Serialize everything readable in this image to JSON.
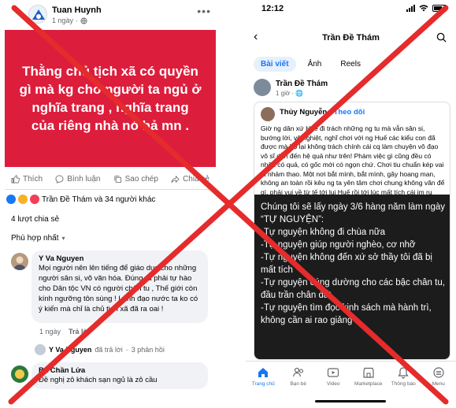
{
  "left_post": {
    "author": "Tuan Huynh",
    "time": "1 ngày",
    "image_text": "Thằng chủ tịch xã có quyền gì mà kg cho người ta ngủ ở nghĩa trang , nghĩa trang của riêng nhà nó hả mn .",
    "actions": {
      "like": "Thích",
      "comment": "Bình luận",
      "copy": "Sao chép",
      "share": "Chia sẻ"
    },
    "reactions_text": "Trần Đề Thám và 34 người khác",
    "shares": "4 lượt chia sẻ",
    "sort_label": "Phù hợp nhất",
    "comment1": {
      "name": "Y Va Nguyen",
      "text": "Mọi người nên lên tiếng để giáo dục cho những người sân si, võ văn hóa. Đúng ra phải tự hào cho Dân tộc VN có người chân tu , Thế giới còn kính ngưỡng tôn sùng ! Lãnh đạo nước ta ko có ý kiến mà chỉ là chủ tịch xã đã ra oai !",
      "time": "1 ngày",
      "reply": "Trả lời"
    },
    "reply_row": {
      "name": "Y Va Nguyen",
      "action": "đã trả lời",
      "count": "3 phản hồi"
    },
    "comment2": {
      "name": "Bá Chần Lửa",
      "text": "Đề nghị zô khách sạn ngủ là zô cầu"
    }
  },
  "right_post": {
    "status_time": "12:12",
    "nav_title": "Trần Đề Thám",
    "tabs": [
      "Bài viết",
      "Ảnh",
      "Reels"
    ],
    "author": "Trần Đề Thám",
    "time": "1 giờ",
    "shared_author": "Thủy Nguyễn",
    "follow": "Theo dõi",
    "shared_text": "Giờ ng dân xứ Huế đi trách những ng tu mà vẫn sân si, bướng lời, vô nghiệt, nghĩ chơi với ng Huế các kiểu con đã được mà họ lại không trách chính cái cq làm chuyện vô đạo vô sĩ dẫn đến hệ quả như trên! Phàm việc gì cũng đều có nhân có quả, có gốc mới có ngọn chứ. Chơi tiu chuẩn kép vai là nhảm thao. Một nơi bắt mình, bắt mình, gây hoang man, không an toàn rồi kêu ng ta yên tâm chơi chung không văn để gì, phải vui về từ tế tới lui Huế rồi tới lúc mất tích cái im ru mặc kệ coi sao đặng😓😓😓",
    "dark_text": [
      "Chúng tôi sẽ lấy ngày 3/6 hàng năm làm ngày “TỰ NGUYỆN”:",
      "-Tự nguyện không đi chùa nữa",
      "-Tự nguyện giúp người nghèo, cơ nhỡ",
      "-Tự nguyện không đến xứ sở thầy tôi đã bị mất tích",
      "-Tự nguyện cúng dường cho các bậc chân tu, đầu trần chân đất",
      "-Tự nguyện tìm đọc kinh sách mà hành trì, không cần ai rao giảng"
    ],
    "bottom_nav": [
      "Trang chủ",
      "Bạn bè",
      "Video",
      "Marketplace",
      "Thông báo",
      "Menu"
    ]
  },
  "colors": {
    "red_card": "#dd1d3c",
    "x_mark": "#e52b2b",
    "fb_blue": "#1877f2",
    "dark_image": "#1c1c1c"
  }
}
